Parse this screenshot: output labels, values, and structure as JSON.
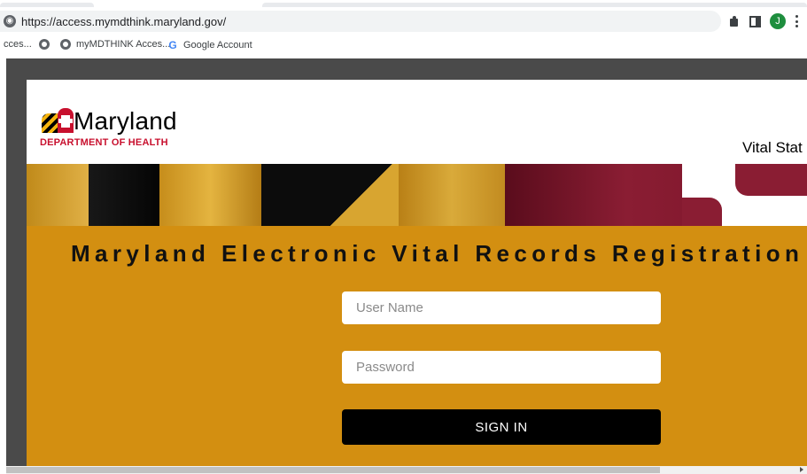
{
  "browser": {
    "url": "https://access.mymdthink.maryland.gov/",
    "avatar_initial": "J",
    "bookmarks": [
      {
        "label": "cces...",
        "icon": "none"
      },
      {
        "label": "",
        "icon": "globe-icon"
      },
      {
        "label": "myMDTHINK Acces...",
        "icon": "globe-icon"
      },
      {
        "label": "Google Account",
        "icon": "google-icon"
      }
    ]
  },
  "header": {
    "brand": "Maryland",
    "department": "DEPARTMENT OF HEALTH",
    "vital_text": "Vital Stat"
  },
  "main": {
    "title": "Maryland Electronic Vital Records Registration",
    "username_placeholder": "User Name",
    "password_placeholder": "Password",
    "signin_label": "SIGN IN"
  },
  "colors": {
    "gold": "#d38f11",
    "maryland_red": "#c8102e",
    "button": "#000000"
  }
}
